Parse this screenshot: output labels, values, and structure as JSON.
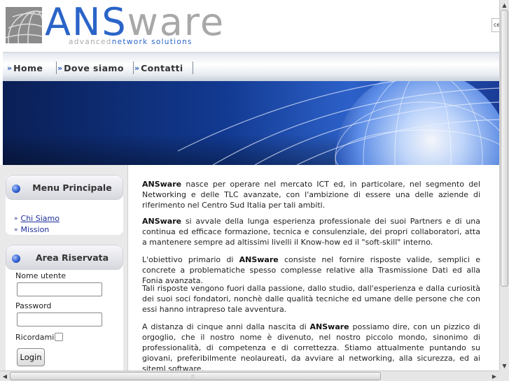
{
  "header": {
    "logo_part1": "ANS",
    "logo_part2": "ware",
    "tagline_part1": "advanced",
    "tagline_part2": "network solutions",
    "search_value": "ce"
  },
  "nav": {
    "items": [
      {
        "label": "Home"
      },
      {
        "label": "Dove siamo"
      },
      {
        "label": "Contatti"
      }
    ],
    "arrow_glyph": "»"
  },
  "sidebar": {
    "menu": {
      "title": "Menu Principale",
      "items": [
        {
          "label": "Chi Siamo"
        },
        {
          "label": "Mission"
        }
      ]
    },
    "reserved": {
      "title": "Area Riservata",
      "username_label": "Nome utente",
      "password_label": "Password",
      "remember_label": "Ricordami",
      "login_label": "Login",
      "username_value": "",
      "password_value": ""
    }
  },
  "content": {
    "p1_brand": "ANSware",
    "p1_text": " nasce per operare nel mercato ICT ed, in particolare, nel segmento del Networking e delle TLC avanzate, con l'ambizione di essere una delle aziende di riferimento nel Centro Sud Italia per tali ambiti.",
    "p2_brand": "ANSware",
    "p2_text": " si avvale della lunga esperienza professionale dei suoi Partners e di una continua ed efficace formazione, tecnica e consulenziale, dei propri collaboratori, atta a mantenere sempre ad altissimi livelli il Know-how ed il \"soft-skill\" interno.",
    "p3_text_a": "L'obiettivo primario di ",
    "p3_brand": "ANSware",
    "p3_text_b": " consiste nel fornire risposte valide, semplici e concrete a problematiche spesso complesse relative alla Trasmissione Dati ed alla Fonia avanzata.",
    "p4_text": "Tali risposte vengono fuori dalla passione, dallo studio, dall'esperienza e dalla curiosità dei suoi soci fondatori, nonchè dalle qualità tecniche ed umane delle persone che con essi hanno intrapreso tale avventura.",
    "p5_text_a": "A distanza di cinque anni dalla nascita di ",
    "p5_brand": "ANSware",
    "p5_text_b": " possiamo dire, con un pizzico di orgoglio, che il nostro nome è divenuto, nel nostro piccolo mondo, sinonimo di professionalità, di competenza e di correttezza. Stiamo attualmente puntando su giovani, preferibilmente neolaureati, da avviare al networking, alla sicurezza, ed ai siteml software."
  },
  "colors": {
    "brand_blue": "#2a64c8",
    "brand_grey": "#a8a8a8",
    "link_blue": "#1d2e9a"
  },
  "icons": {
    "logo": "globe-grid-logo",
    "nav_arrow": "double-chevron-right-icon",
    "panel_bullet": "blue-sphere-icon",
    "link_arrow": "double-chevron-right-icon"
  }
}
